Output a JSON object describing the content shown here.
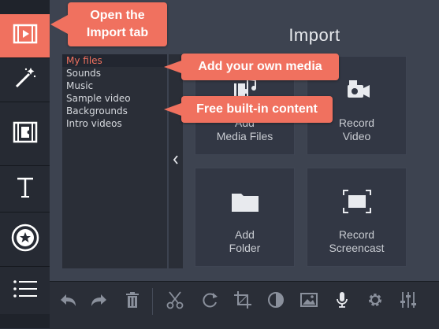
{
  "sidebar": {
    "items": [
      {
        "name": "import",
        "icon": "film-play-icon",
        "active": true
      },
      {
        "name": "filters",
        "icon": "magic-wand-icon",
        "active": false
      },
      {
        "name": "transitions",
        "icon": "film-transition-icon",
        "active": false
      },
      {
        "name": "titles",
        "icon": "text-t-icon",
        "active": false
      },
      {
        "name": "stickers",
        "icon": "star-badge-icon",
        "active": false
      },
      {
        "name": "more",
        "icon": "list-icon",
        "active": false
      }
    ],
    "active_color": "#f0715f"
  },
  "main": {
    "title": "Import",
    "folders": [
      {
        "label": "My files",
        "active": true
      },
      {
        "label": "Sounds",
        "active": false
      },
      {
        "label": "Music",
        "active": false
      },
      {
        "label": "Sample video",
        "active": false
      },
      {
        "label": "Backgrounds",
        "active": false
      },
      {
        "label": "Intro videos",
        "active": false
      }
    ],
    "tiles": [
      {
        "line1": "Add",
        "line2": "Media Files",
        "icon": "media-files-icon"
      },
      {
        "line1": "Record",
        "line2": "Video",
        "icon": "camera-icon"
      },
      {
        "line1": "Add",
        "line2": "Folder",
        "icon": "folder-icon"
      },
      {
        "line1": "Record",
        "line2": "Screencast",
        "icon": "screencast-icon"
      }
    ]
  },
  "toolbar": {
    "tools": [
      "undo-icon",
      "redo-icon",
      "trash-icon",
      "scissors-icon",
      "rotate-icon",
      "crop-icon",
      "color-adjust-icon",
      "image-icon",
      "microphone-icon",
      "gear-icon",
      "equalizer-icon"
    ]
  },
  "callouts": {
    "open_import_line1": "Open the",
    "open_import_line2": "Import tab",
    "add_media": "Add your own media",
    "free_content": "Free built-in content"
  },
  "colors": {
    "accent": "#f0715f",
    "panel": "#3d4350",
    "sidebar": "#1f232b"
  }
}
